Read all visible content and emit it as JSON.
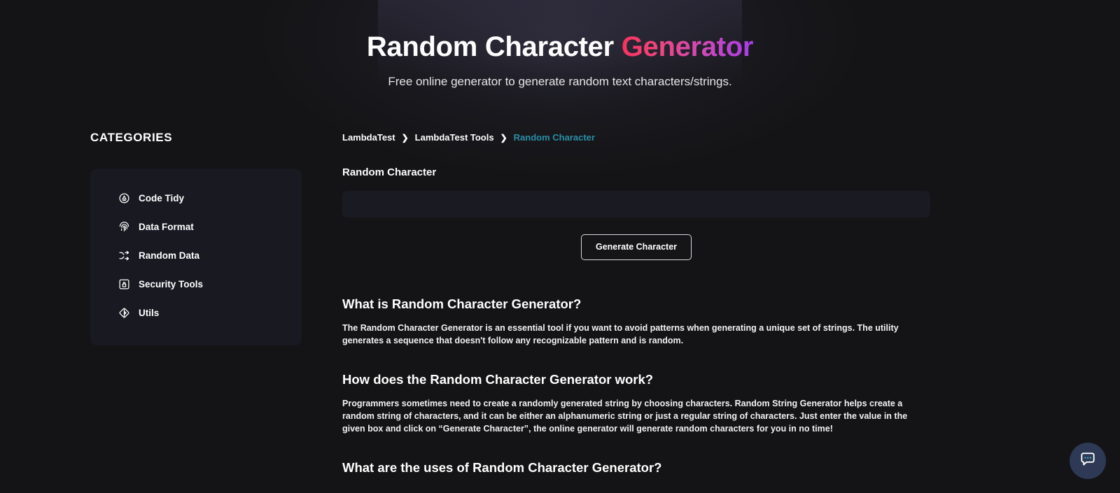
{
  "hero": {
    "title_main": "Random Character ",
    "title_accent": "Generator",
    "subtitle": "Free online generator to generate random text characters/strings.",
    "accent_gradient_start": "#f8325f",
    "accent_gradient_end": "#a73ce8"
  },
  "sidebar": {
    "title": "CATEGORIES",
    "items": [
      {
        "label": "Code Tidy",
        "icon": "code-tidy-icon"
      },
      {
        "label": "Data Format",
        "icon": "fingerprint-icon"
      },
      {
        "label": "Random Data",
        "icon": "shuffle-icon"
      },
      {
        "label": "Security Tools",
        "icon": "lock-icon"
      },
      {
        "label": "Utils",
        "icon": "utils-diamond-icon"
      }
    ]
  },
  "breadcrumb": {
    "separator": "❯",
    "items": [
      {
        "label": "LambdaTest",
        "current": false
      },
      {
        "label": "LambdaTest Tools",
        "current": false
      },
      {
        "label": "Random Character",
        "current": true
      }
    ],
    "current_color": "#2a8fa8"
  },
  "tool": {
    "field_label": "Random Character",
    "output_value": "",
    "output_placeholder": "",
    "generate_label": "Generate Character"
  },
  "faq": [
    {
      "heading": "What is Random Character Generator?",
      "body": "The Random Character Generator is an essential tool if you want to avoid patterns when generating a unique set of strings. The utility generates a sequence that doesn't follow any recognizable pattern and is random."
    },
    {
      "heading": "How does the Random Character Generator work?",
      "body": "Programmers sometimes need to create a randomly generated string by choosing characters. Random String Generator helps create a random string of characters, and it can be either an alphanumeric string or just a regular string of characters. Just enter the value in the given box and click on “Generate Character”, the online generator will generate random characters for you in no time!"
    },
    {
      "heading": "What are the uses of Random Character Generator?",
      "body": ""
    }
  ],
  "chat": {
    "icon": "chat-bubble-icon",
    "background_color": "#2d3955",
    "dot_color": "#3fb3c6"
  }
}
